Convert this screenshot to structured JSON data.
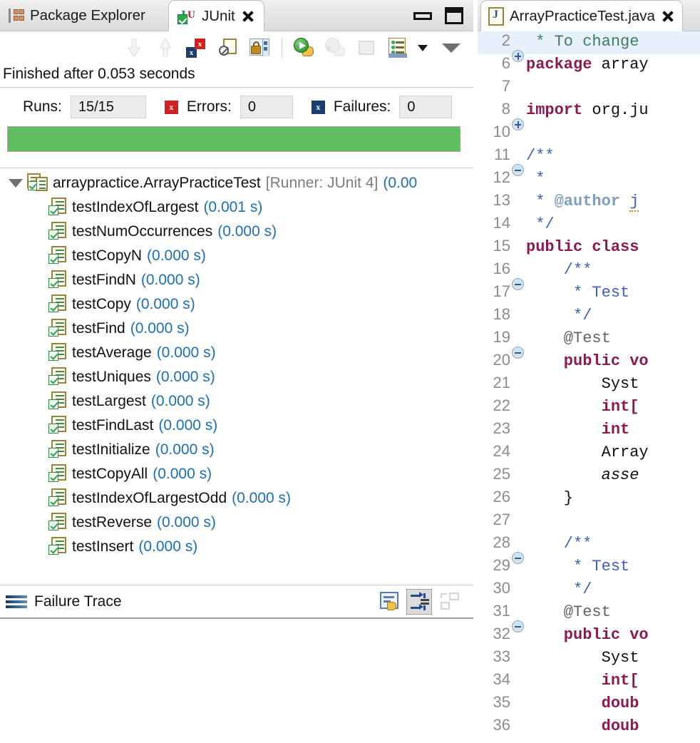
{
  "left_view": {
    "tabs": [
      {
        "label": "Package Explorer",
        "icon": "package-explorer-icon",
        "active": false
      },
      {
        "label": "JUnit",
        "icon": "junit-icon",
        "active": true,
        "closeable": true
      }
    ],
    "window_controls": {
      "minimize": "minimize-button",
      "maximize": "maximize-button"
    },
    "toolbar": [
      {
        "name": "next-failure-button",
        "icon": "arrow-down-icon",
        "enabled": false
      },
      {
        "name": "previous-failure-button",
        "icon": "arrow-up-icon",
        "enabled": false
      },
      {
        "name": "show-failures-only-button",
        "icon": "failures-x-icon",
        "enabled": true
      },
      {
        "name": "filter-stack-trace-button",
        "icon": "no-filter-icon",
        "enabled": true
      },
      {
        "name": "scroll-lock-button",
        "icon": "lock-icon",
        "enabled": true
      },
      {
        "name": "rerun-test-button",
        "icon": "run-green-icon",
        "enabled": true
      },
      {
        "name": "rerun-failed-tests-button",
        "icon": "run-failed-icon",
        "enabled": false
      },
      {
        "name": "stop-button",
        "icon": "stop-icon",
        "enabled": false
      },
      {
        "name": "test-run-history-button",
        "icon": "history-icon",
        "enabled": true
      },
      {
        "name": "history-dropdown-button",
        "icon": "caret-down-icon",
        "enabled": true
      },
      {
        "name": "view-menu-button",
        "icon": "view-menu-icon",
        "enabled": true
      }
    ],
    "status": "Finished after 0.053 seconds",
    "counters": {
      "runs_label": "Runs:",
      "runs_value": "15/15",
      "errors_label": "Errors:",
      "errors_value": "0",
      "failures_label": "Failures:",
      "failures_value": "0"
    },
    "progress": {
      "percent": 100,
      "color": "#5fbf60",
      "state": "pass"
    },
    "tree": {
      "root": {
        "name": "arraypractice.ArrayPracticeTest",
        "runner": "[Runner: JUnit 4]",
        "time": "(0.00",
        "expanded": true
      },
      "tests": [
        {
          "name": "testIndexOfLargest",
          "time": "(0.001 s)"
        },
        {
          "name": "testNumOccurrences",
          "time": "(0.000 s)"
        },
        {
          "name": "testCopyN",
          "time": "(0.000 s)"
        },
        {
          "name": "testFindN",
          "time": "(0.000 s)"
        },
        {
          "name": "testCopy",
          "time": "(0.000 s)"
        },
        {
          "name": "testFind",
          "time": "(0.000 s)"
        },
        {
          "name": "testAverage",
          "time": "(0.000 s)"
        },
        {
          "name": "testUniques",
          "time": "(0.000 s)"
        },
        {
          "name": "testLargest",
          "time": "(0.000 s)"
        },
        {
          "name": "testFindLast",
          "time": "(0.000 s)"
        },
        {
          "name": "testInitialize",
          "time": "(0.000 s)"
        },
        {
          "name": "testCopyAll",
          "time": "(0.000 s)"
        },
        {
          "name": "testIndexOfLargestOdd",
          "time": "(0.000 s)"
        },
        {
          "name": "testReverse",
          "time": "(0.000 s)"
        },
        {
          "name": "testInsert",
          "time": "(0.000 s)"
        }
      ]
    },
    "failure_trace": {
      "title": "Failure Trace",
      "tools": [
        {
          "name": "compare-result-button",
          "icon": "compare-icon",
          "enabled": true,
          "pressed": false
        },
        {
          "name": "filter-stack-frames-button",
          "icon": "stack-filter-icon",
          "enabled": true,
          "pressed": true
        },
        {
          "name": "view-layout-button",
          "icon": "layout-icon",
          "enabled": false,
          "pressed": false
        }
      ],
      "content": ""
    }
  },
  "editor": {
    "tab": {
      "label": "ArrayPracticeTest.java",
      "icon": "java-file-icon",
      "closeable": true
    },
    "lines": [
      {
        "num": "2",
        "fold": "plus",
        "highlight": true,
        "segments": [
          {
            "text": " * To change",
            "cls": "c-cmt-hl"
          }
        ]
      },
      {
        "num": "6",
        "fold": "",
        "highlight": false,
        "segments": [
          {
            "text": "package ",
            "cls": "c-kw"
          },
          {
            "text": "array",
            "cls": "c-plain"
          }
        ]
      },
      {
        "num": "7",
        "fold": "",
        "highlight": false,
        "segments": [
          {
            "text": "",
            "cls": "c-plain"
          }
        ]
      },
      {
        "num": "8",
        "fold": "plus",
        "highlight": false,
        "segments": [
          {
            "text": "import ",
            "cls": "c-kw"
          },
          {
            "text": "org.ju",
            "cls": "c-plain"
          }
        ]
      },
      {
        "num": "10",
        "fold": "",
        "highlight": false,
        "segments": [
          {
            "text": "",
            "cls": "c-plain"
          }
        ]
      },
      {
        "num": "11",
        "fold": "minus",
        "highlight": false,
        "segments": [
          {
            "text": "/**",
            "cls": "c-cmt"
          }
        ]
      },
      {
        "num": "12",
        "fold": "",
        "highlight": false,
        "segments": [
          {
            "text": " *",
            "cls": "c-cmt"
          }
        ]
      },
      {
        "num": "13",
        "fold": "",
        "highlight": false,
        "segments": [
          {
            "text": " * ",
            "cls": "c-cmt"
          },
          {
            "text": "@author ",
            "cls": "c-jdoc-tag"
          },
          {
            "text": "j",
            "cls": "c-cmt spell"
          }
        ]
      },
      {
        "num": "14",
        "fold": "",
        "highlight": false,
        "segments": [
          {
            "text": " */",
            "cls": "c-cmt"
          }
        ]
      },
      {
        "num": "15",
        "fold": "",
        "highlight": false,
        "segments": [
          {
            "text": "public class ",
            "cls": "c-kw"
          }
        ]
      },
      {
        "num": "16",
        "fold": "minus",
        "highlight": false,
        "segments": [
          {
            "text": "    /**",
            "cls": "c-cmt"
          }
        ]
      },
      {
        "num": "17",
        "fold": "",
        "highlight": false,
        "segments": [
          {
            "text": "     * Test ",
            "cls": "c-cmt"
          }
        ]
      },
      {
        "num": "18",
        "fold": "",
        "highlight": false,
        "segments": [
          {
            "text": "     */",
            "cls": "c-cmt"
          }
        ]
      },
      {
        "num": "19",
        "fold": "minus",
        "highlight": false,
        "segments": [
          {
            "text": "    @Test",
            "cls": "c-ann"
          }
        ]
      },
      {
        "num": "20",
        "fold": "",
        "highlight": false,
        "segments": [
          {
            "text": "    public vo",
            "cls": "c-kw"
          }
        ]
      },
      {
        "num": "21",
        "fold": "",
        "highlight": false,
        "segments": [
          {
            "text": "        Syst",
            "cls": "c-plain"
          }
        ]
      },
      {
        "num": "22",
        "fold": "",
        "highlight": false,
        "segments": [
          {
            "text": "        int[",
            "cls": "c-kw"
          }
        ]
      },
      {
        "num": "23",
        "fold": "",
        "highlight": false,
        "segments": [
          {
            "text": "        int ",
            "cls": "c-kw"
          }
        ]
      },
      {
        "num": "24",
        "fold": "",
        "highlight": false,
        "segments": [
          {
            "text": "        Array",
            "cls": "c-plain"
          }
        ]
      },
      {
        "num": "25",
        "fold": "",
        "highlight": false,
        "segments": [
          {
            "text": "        asse",
            "cls": "c-plain c-static"
          }
        ]
      },
      {
        "num": "26",
        "fold": "",
        "highlight": false,
        "segments": [
          {
            "text": "    }",
            "cls": "c-plain"
          }
        ]
      },
      {
        "num": "27",
        "fold": "",
        "highlight": false,
        "segments": [
          {
            "text": "",
            "cls": "c-plain"
          }
        ]
      },
      {
        "num": "28",
        "fold": "minus",
        "highlight": false,
        "segments": [
          {
            "text": "    /**",
            "cls": "c-cmt"
          }
        ]
      },
      {
        "num": "29",
        "fold": "",
        "highlight": false,
        "segments": [
          {
            "text": "     * Test ",
            "cls": "c-cmt"
          }
        ]
      },
      {
        "num": "30",
        "fold": "",
        "highlight": false,
        "segments": [
          {
            "text": "     */",
            "cls": "c-cmt"
          }
        ]
      },
      {
        "num": "31",
        "fold": "minus",
        "highlight": false,
        "segments": [
          {
            "text": "    @Test",
            "cls": "c-ann"
          }
        ]
      },
      {
        "num": "32",
        "fold": "",
        "highlight": false,
        "segments": [
          {
            "text": "    public vo",
            "cls": "c-kw"
          }
        ]
      },
      {
        "num": "33",
        "fold": "",
        "highlight": false,
        "segments": [
          {
            "text": "        Syst",
            "cls": "c-plain"
          }
        ]
      },
      {
        "num": "34",
        "fold": "",
        "highlight": false,
        "segments": [
          {
            "text": "        int[",
            "cls": "c-kw"
          }
        ]
      },
      {
        "num": "35",
        "fold": "",
        "highlight": false,
        "segments": [
          {
            "text": "        doub",
            "cls": "c-kw"
          }
        ]
      },
      {
        "num": "36",
        "fold": "",
        "highlight": false,
        "segments": [
          {
            "text": "        doub",
            "cls": "c-kw"
          }
        ]
      }
    ]
  }
}
